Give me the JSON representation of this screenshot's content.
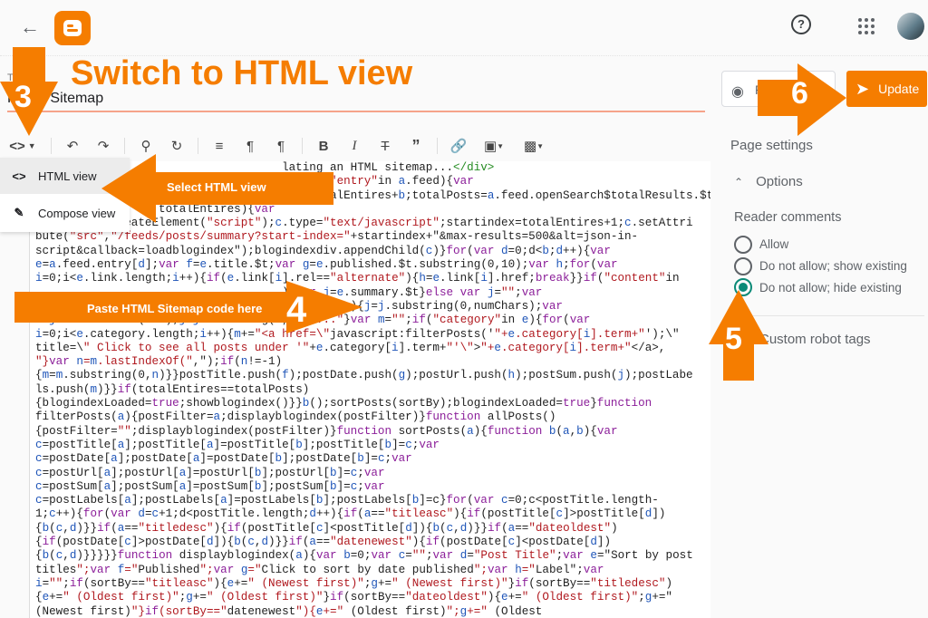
{
  "header": {
    "back_icon": "arrow-left-icon",
    "logo_icon": "blogger-logo-icon",
    "help_icon": "help-circle-icon",
    "apps_icon": "apps-grid-icon",
    "avatar_icon": "user-avatar"
  },
  "editor": {
    "title_label": "Title",
    "title_value": "HTML Sitemap",
    "toolbar": {
      "view_toggle": "<>",
      "icons": [
        "undo-icon",
        "redo-icon",
        "search-icon",
        "search-replace-icon",
        "align-icon",
        "ltr-icon",
        "rtl-icon",
        "bold-icon",
        "italic-icon",
        "strikethrough-icon",
        "quote-icon",
        "link-icon",
        "image-icon",
        "video-icon"
      ],
      "bold": "B",
      "italic": "I"
    },
    "view_menu": {
      "items": [
        {
          "label": "HTML view",
          "icon": "<>",
          "selected": true
        },
        {
          "label": "Compose view",
          "icon": "pencil-icon",
          "selected": false
        }
      ]
    },
    "code_lines": [
      "                                    lating an HTML sitemap...</div>",
      "                                    b(){if(\"entry\"in a.feed){var",
      "                  /.length;totalEntires=totalEntires+b;totalPosts=a.feed.openSearch$totalResults.$t;i",
      "                  totalEntires){var",
      "c=document.createElement(\"script\");c.type=\"text/javascript\";startindex=totalEntires+1;c.setAttri",
      "bute(\"src\",\"/feeds/posts/summary?start-index=\"+startindex+\"&max-results=500&alt=json-in-",
      "script&callback=loadblogindex\");blogindexdiv.appendChild(c)}for(var d=0;d<b;d++){var",
      "e=a.feed.entry[d];var f=e.title.$t;var g=e.published.$t.substring(0,10);var h;for(var",
      "i=0;i<e.link.length;i++){if(e.link[i].rel==\"alternate\"){h=e.link[i].href;break}}if(\"content\"in",
      "                                    ){var j=e.summary.$t}else var j=\"\";var",
      "                                  gth>numChars){j=j.substring(0,numChars);var",
      "l=j.lastIndexOf(\" \");j=j.substring(0,l)+\"...\"}var m=\"\";if(\"category\"in e){for(var",
      "i=0;i<e.category.length;i++){m+=\"<a href=\\\"javascript:filterPosts('\"+e.category[i].term+\"');\\\"",
      "title=\\\" Click to see all posts under '\"+e.category[i].term+\"'\\\">\"+e.category[i].term+\"</a>,",
      "\"}var n=m.lastIndexOf(\",\");if(n!=-1)",
      "{m=m.substring(0,n)}}postTitle.push(f);postDate.push(g);postUrl.push(h);postSum.push(j);postLabe",
      "ls.push(m)}}if(totalEntires==totalPosts)",
      "{blogindexLoaded=true;showblogindex()}}b();sortPosts(sortBy);blogindexLoaded=true}function",
      "filterPosts(a){postFilter=a;displayblogindex(postFilter)}function allPosts()",
      "{postFilter=\"\";displayblogindex(postFilter)}function sortPosts(a){function b(a,b){var",
      "c=postTitle[a];postTitle[a]=postTitle[b];postTitle[b]=c;var",
      "c=postDate[a];postDate[a]=postDate[b];postDate[b]=c;var",
      "c=postUrl[a];postUrl[a]=postUrl[b];postUrl[b]=c;var",
      "c=postSum[a];postSum[a]=postSum[b];postSum[b]=c;var",
      "c=postLabels[a];postLabels[a]=postLabels[b];postLabels[b]=c}for(var c=0;c<postTitle.length-",
      "1;c++){for(var d=c+1;d<postTitle.length;d++){if(a==\"titleasc\"){if(postTitle[c]>postTitle[d])",
      "{b(c,d)}}if(a==\"titledesc\"){if(postTitle[c]<postTitle[d]){b(c,d)}}if(a==\"dateoldest\")",
      "{if(postDate[c]>postDate[d]){b(c,d)}}if(a==\"datenewest\"){if(postDate[c]<postDate[d])",
      "{b(c,d)}}}}}function displayblogindex(a){var b=0;var c=\"\";var d=\"Post Title\";var e=\"Sort by post",
      "titles\";var f=\"Published\";var g=\"Click to sort by date published\";var h=\"Label\";var",
      "i=\"\";if(sortBy==\"titleasc\"){e+=\" (Newest first)\";g+=\" (Newest first)\"}if(sortBy==\"titledesc\")",
      "{e+=\" (Oldest first)\";g+=\" (Oldest first)\"}if(sortBy==\"dateoldest\"){e+=\" (Oldest first)\";g+=\"",
      "(Newest first)\"}if(sortBy==\"datenewest\"){e+=\" (Oldest first)\";g+=\" (Oldest"
    ]
  },
  "sidebar": {
    "preview_label": "Preview",
    "preview_icon": "eye-icon",
    "update_label": "Update",
    "update_icon": "send-icon",
    "page_settings": "Page settings",
    "options_label": "Options",
    "options_icon": "chevron-up-icon",
    "reader_comments_label": "Reader comments",
    "reader_comments_options": [
      {
        "label": "Allow",
        "selected": false
      },
      {
        "label": "Do not allow; show existing",
        "selected": false
      },
      {
        "label": "Do not allow; hide existing",
        "selected": true
      }
    ],
    "custom_robot_tags": "Custom robot tags"
  },
  "annotations": {
    "heading": "Switch to HTML view",
    "select_html_view": "Select HTML view",
    "paste_code": "Paste HTML  Sitemap code here",
    "step3": "3",
    "step4": "4",
    "step5": "5",
    "step6": "6",
    "accent": "#f57d00"
  }
}
